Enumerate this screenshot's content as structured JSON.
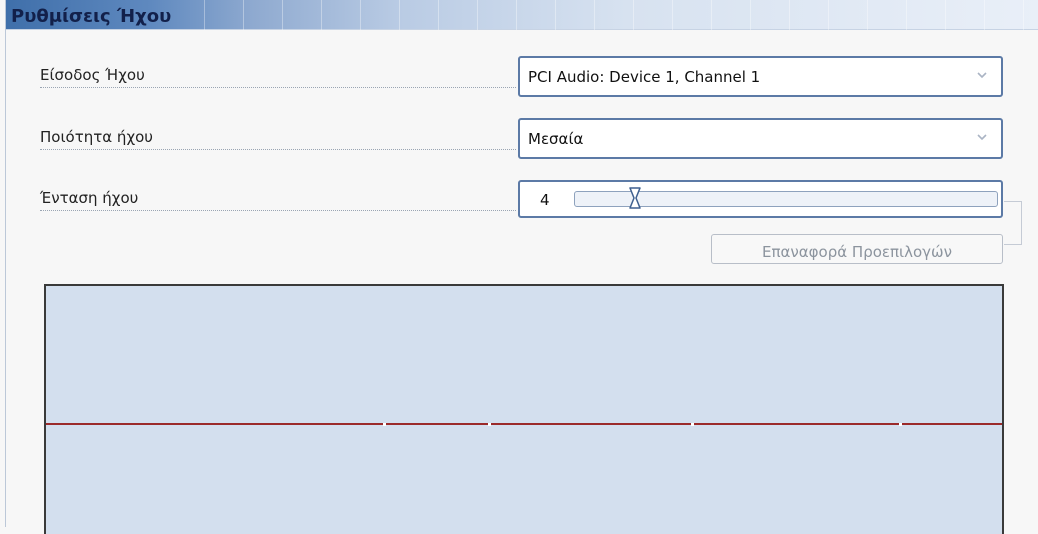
{
  "panel": {
    "title": "Ρυθμίσεις Ήχου"
  },
  "audio_input": {
    "label": "Είσοδος Ήχου",
    "selected": "PCI Audio: Device 1, Channel 1"
  },
  "audio_quality": {
    "label": "Ποιότητα ήχου",
    "selected": "Μεσαία"
  },
  "volume": {
    "label": "Ένταση ήχου",
    "value": "4",
    "level_fraction": 0.13
  },
  "reset_button": {
    "label": "Επαναφορά Προεπιλογών"
  },
  "waveform": {
    "line_color": "#9b2a2a",
    "background_color": "#d3dfee"
  },
  "icons": {
    "dropdown": "chevron-down-icon",
    "slider_thumb": "hourglass-thumb-icon"
  }
}
